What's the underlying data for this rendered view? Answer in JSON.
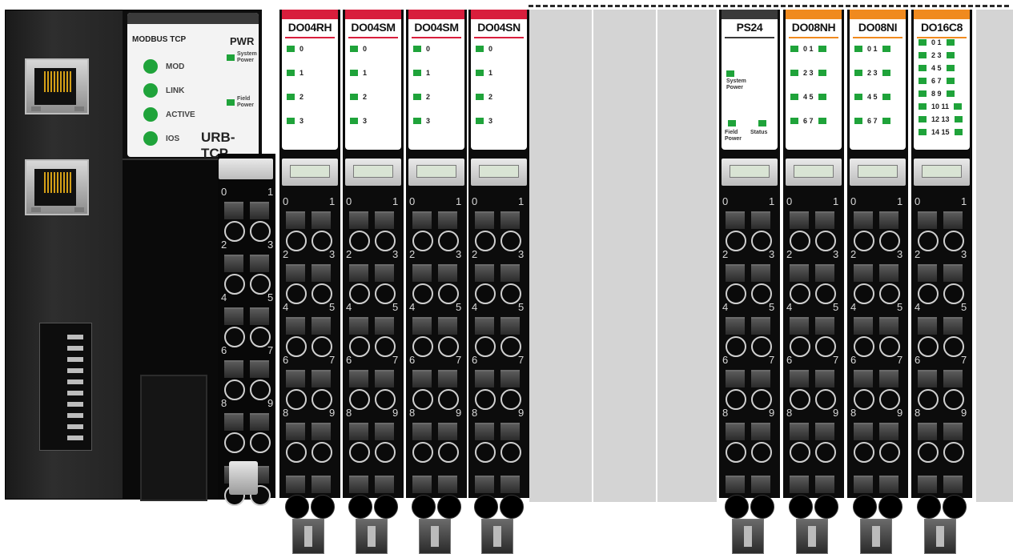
{
  "head_module": {
    "protocol": "MODBUS TCP",
    "pwr_title": "PWR",
    "system_power": "System Power",
    "field_power": "Field Power",
    "leds": [
      "MOD",
      "LINK",
      "ACTIVE",
      "IOS"
    ],
    "model": "URB-TCP",
    "terminal_numbers": [
      "0",
      "1",
      "2",
      "3",
      "4",
      "5",
      "6",
      "7",
      "8",
      "9"
    ]
  },
  "io_modules": [
    {
      "name": "DO04RH",
      "accent": "#d81e3c",
      "channels": [
        "0",
        "1",
        "2",
        "3"
      ]
    },
    {
      "name": "DO04SM",
      "accent": "#d81e3c",
      "channels": [
        "0",
        "1",
        "2",
        "3"
      ]
    },
    {
      "name": "DO04SM",
      "accent": "#d81e3c",
      "channels": [
        "0",
        "1",
        "2",
        "3"
      ]
    },
    {
      "name": "DO04SN",
      "accent": "#d81e3c",
      "channels": [
        "0",
        "1",
        "2",
        "3"
      ]
    }
  ],
  "power_module": {
    "name": "PS24",
    "accent": "#3a3a3a",
    "system_power": "System Power",
    "field_power": "Field Power",
    "status": "Status"
  },
  "io_modules_right": [
    {
      "name": "DO08NH",
      "accent": "#f08a1e",
      "channels": [
        "0 1",
        "2 3",
        "4 5",
        "6 7"
      ]
    },
    {
      "name": "DO08NI",
      "accent": "#f08a1e",
      "channels": [
        "0 1",
        "2 3",
        "4 5",
        "6 7"
      ]
    },
    {
      "name": "DO16C8",
      "accent": "#f08a1e",
      "channels": [
        "0 1",
        "2 3",
        "4 5",
        "6 7",
        "8 9",
        "10 11",
        "12 13",
        "14 15"
      ]
    }
  ],
  "terminal_numbers": [
    "0",
    "1",
    "2",
    "3",
    "4",
    "5",
    "6",
    "7",
    "8",
    "9"
  ]
}
